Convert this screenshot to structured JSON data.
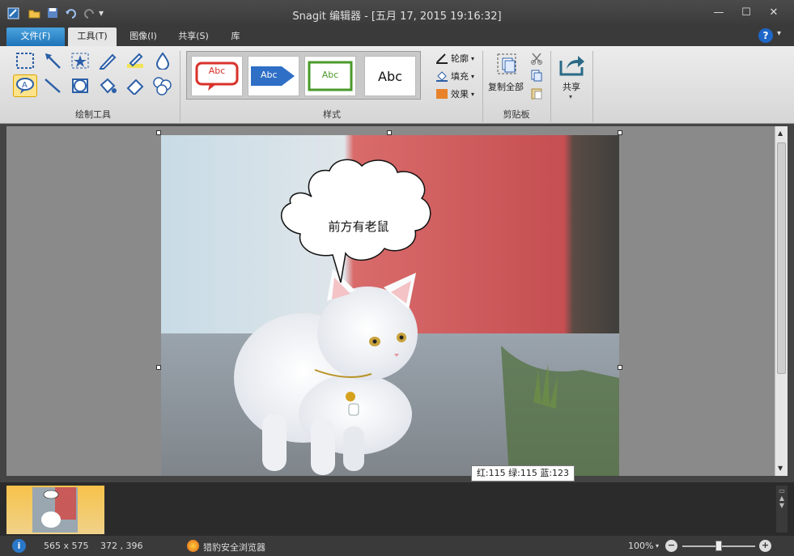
{
  "window": {
    "title": "Snagit 编辑器 - [五月 17, 2015 19:16:32]"
  },
  "tabs": {
    "file": "文件(F)",
    "tools": "工具(T)",
    "image": "图像(I)",
    "share": "共享(S)",
    "library": "库"
  },
  "ribbon": {
    "draw_tools_label": "绘制工具",
    "styles_label": "样式",
    "styles": [
      "Abc",
      "Abc",
      "Abc",
      "Abc"
    ],
    "outline_label": "轮廓",
    "fill_label": "填充",
    "effects_label": "效果",
    "copy_all_label": "复制全部",
    "clipboard_label": "剪贴板",
    "share_label": "共享"
  },
  "canvas": {
    "callout_text": "前方有老鼠",
    "color_tooltip": "红:115 绿:115 蓝:123"
  },
  "status": {
    "image_size": "565 x 575",
    "cursor_pos": "372 , 396",
    "browser_app": "猎豹安全浏览器",
    "zoom": "100%"
  },
  "colors": {
    "file_tab": "#2a86cc",
    "selected_tool": "#ffe38a",
    "style_red": "#d9312b",
    "style_blue": "#2f6fc6",
    "style_green": "#4a9a2a"
  }
}
